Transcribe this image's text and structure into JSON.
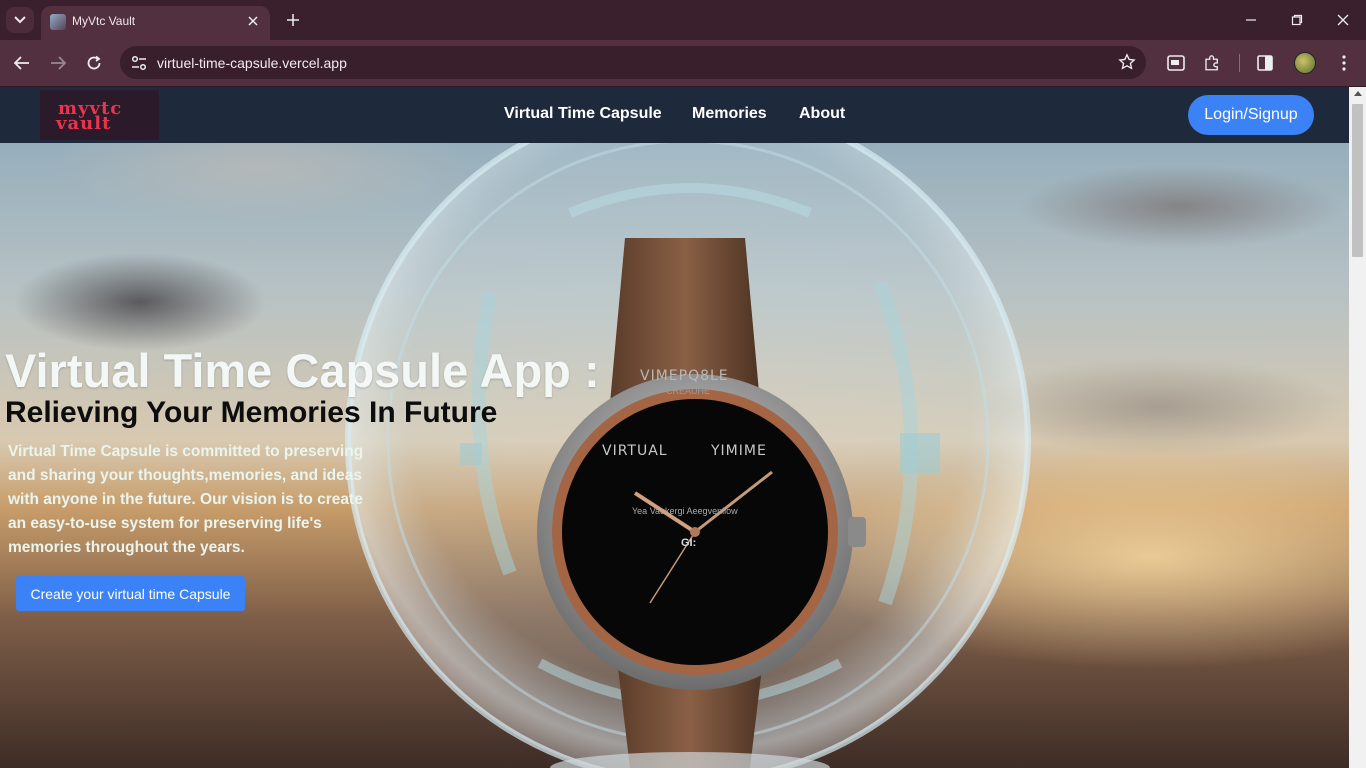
{
  "browser": {
    "tab_title": "MyVtc Vault",
    "url": "virtuel-time-capsule.vercel.app"
  },
  "navbar": {
    "logo_line1": "myvtc",
    "logo_line2": "vault",
    "links": [
      "Virtual Time Capsule",
      "Memories",
      "About"
    ],
    "login_label": "Login/Signup"
  },
  "hero": {
    "title": "Virtual Time Capsule App :",
    "subtitle": "Relieving Your Memories In Future",
    "description": "Virtual Time Capsule is committed to preserving and sharing your thoughts,memories, and ideas with anyone in the future. Our vision is to create an easy-to-use system for preserving life's memories throughout the years.",
    "cta_label": "Create your virtual time Capsule"
  },
  "watch_face": {
    "top_text": "VIMEPQ8LE",
    "top_sub": "CREAUHE",
    "left_text": "VIRTUAL",
    "right_text": "YIMIME",
    "bottom_text": "Yea Vaukergi Aeegvenliow",
    "bottom_mark": "GI:"
  },
  "colors": {
    "accent": "#3b82f6",
    "navbar_bg": "#1e293b",
    "logo_red": "#e8344f"
  }
}
